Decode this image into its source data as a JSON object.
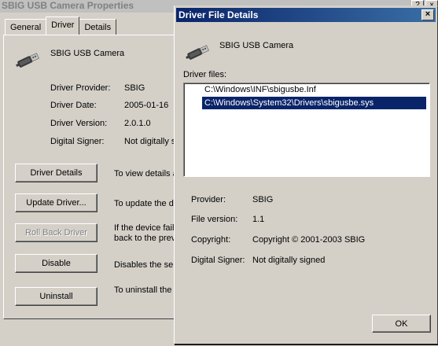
{
  "bg_window": {
    "title": "SBIG USB Camera Properties",
    "title_buttons": [
      "?",
      "×"
    ],
    "tabs": [
      "General",
      "Driver",
      "Details"
    ],
    "active_tab": "Driver",
    "device_name": "SBIG USB Camera",
    "fields": [
      {
        "label": "Driver Provider:",
        "value": "SBIG"
      },
      {
        "label": "Driver Date:",
        "value": "2005-01-16"
      },
      {
        "label": "Driver Version:",
        "value": "2.0.1.0"
      },
      {
        "label": "Digital Signer:",
        "value": "Not digitally s"
      }
    ],
    "buttons": [
      {
        "label": "Driver Details",
        "desc": "To view details a",
        "enabled": true
      },
      {
        "label": "Update Driver...",
        "desc": "To update the d",
        "enabled": true
      },
      {
        "label": "Roll Back Driver",
        "desc": "If the device fail\nback to the prev",
        "enabled": false
      },
      {
        "label": "Disable",
        "desc": "Disables the sele",
        "enabled": true
      },
      {
        "label": "Uninstall",
        "desc": "To uninstall the",
        "enabled": true
      }
    ]
  },
  "dialog": {
    "title": "Driver File Details",
    "close_label": "×",
    "device_name": "SBIG USB Camera",
    "files_label": "Driver files:",
    "files": [
      {
        "path": "C:\\Windows\\INF\\sbigusbe.Inf",
        "selected": false
      },
      {
        "path": "C:\\Windows\\System32\\Drivers\\sbigusbe.sys",
        "selected": true
      }
    ],
    "details": [
      {
        "label": "Provider:",
        "value": "SBIG"
      },
      {
        "label": "File version:",
        "value": "1.1"
      },
      {
        "label": "Copyright:",
        "value": "Copyright © 2001-2003  SBIG"
      },
      {
        "label": "Digital Signer:",
        "value": "Not digitally signed"
      }
    ],
    "ok_label": "OK"
  },
  "colors": {
    "dialog_face": "#d4d0c8",
    "title_active": "#0a246a",
    "selection": "#0a246a"
  },
  "icons": [
    "usb-plug-icon"
  ]
}
